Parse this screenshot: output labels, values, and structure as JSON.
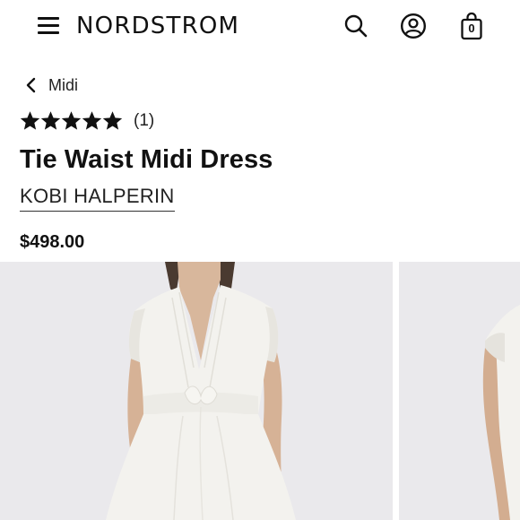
{
  "header": {
    "logo_text": "NORDSTROM",
    "menu_icon": "hamburger-menu-icon",
    "search_icon": "search-icon",
    "account_icon": "account-icon",
    "bag_icon": "shopping-bag-icon",
    "bag_count": "0"
  },
  "breadcrumb": {
    "icon": "chevron-left-icon",
    "label": "Midi"
  },
  "product": {
    "rating_stars": 5,
    "review_count": "(1)",
    "title": "Tie Waist Midi Dress",
    "brand": "KOBI HALPERIN",
    "price": "$498.00"
  },
  "gallery": {
    "images": [
      "product-photo-front",
      "product-photo-side"
    ]
  },
  "colors": {
    "text": "#111111",
    "photo_background": "#eae9ec",
    "dress": "#f3f2ee"
  }
}
